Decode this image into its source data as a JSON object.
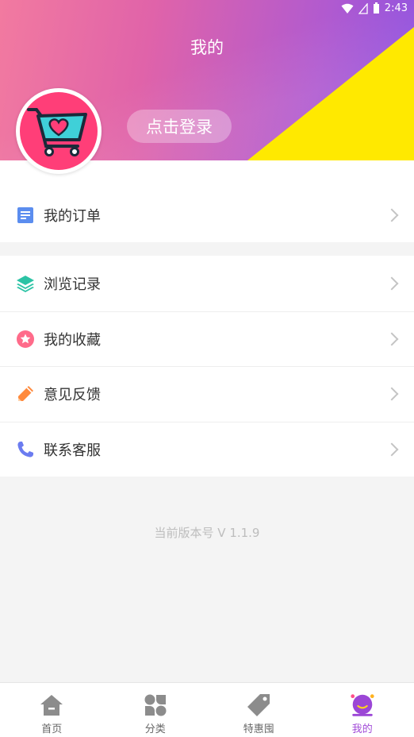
{
  "status_bar": {
    "time": "2:43"
  },
  "header": {
    "title": "我的",
    "login_label": "点击登录"
  },
  "menu_groups": [
    {
      "items": [
        {
          "label": "我的订单",
          "icon": "order-icon",
          "color": "#5b8def"
        }
      ]
    },
    {
      "items": [
        {
          "label": "浏览记录",
          "icon": "layers-icon",
          "color": "#2cc3a5"
        },
        {
          "label": "我的收藏",
          "icon": "star-badge-icon",
          "color": "#ff6b8a"
        },
        {
          "label": "意见反馈",
          "icon": "pencil-icon",
          "color": "#ff8a3d"
        },
        {
          "label": "联系客服",
          "icon": "phone-icon",
          "color": "#6b7cf0"
        }
      ]
    }
  ],
  "version_text": "当前版本号 V 1.1.9",
  "tabs": [
    {
      "label": "首页",
      "icon": "home-icon",
      "active": false
    },
    {
      "label": "分类",
      "icon": "category-icon",
      "active": false
    },
    {
      "label": "特惠囤",
      "icon": "tag-icon",
      "active": false
    },
    {
      "label": "我的",
      "icon": "profile-icon",
      "active": true
    }
  ],
  "colors": {
    "accent": "#a24bd8",
    "header_yellow": "#ffe900",
    "avatar_bg": "#ff3e78"
  }
}
